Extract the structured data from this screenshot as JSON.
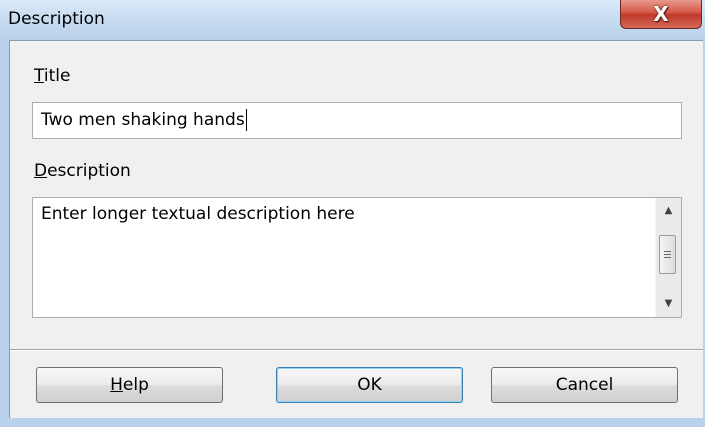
{
  "window": {
    "title": "Description",
    "close_glyph": "X",
    "close_icon": "close-icon"
  },
  "title_field": {
    "label_accel": "T",
    "label_rest": "itle",
    "value": "Two men shaking hands"
  },
  "description_field": {
    "label_accel": "D",
    "label_rest": "escription",
    "value": "Enter longer textual description here"
  },
  "scrollbar": {
    "up_glyph": "▲",
    "down_glyph": "▼",
    "up_icon": "scroll-up-arrow-icon",
    "down_icon": "scroll-down-arrow-icon"
  },
  "buttons": {
    "help_accel": "H",
    "help_rest": "elp",
    "ok_label": "OK",
    "cancel_label": "Cancel"
  },
  "colors": {
    "frame": "#b9d1ea",
    "client_bg": "#f0f0f0",
    "close_red": "#c0392b",
    "ok_border": "#3c7fb1"
  }
}
